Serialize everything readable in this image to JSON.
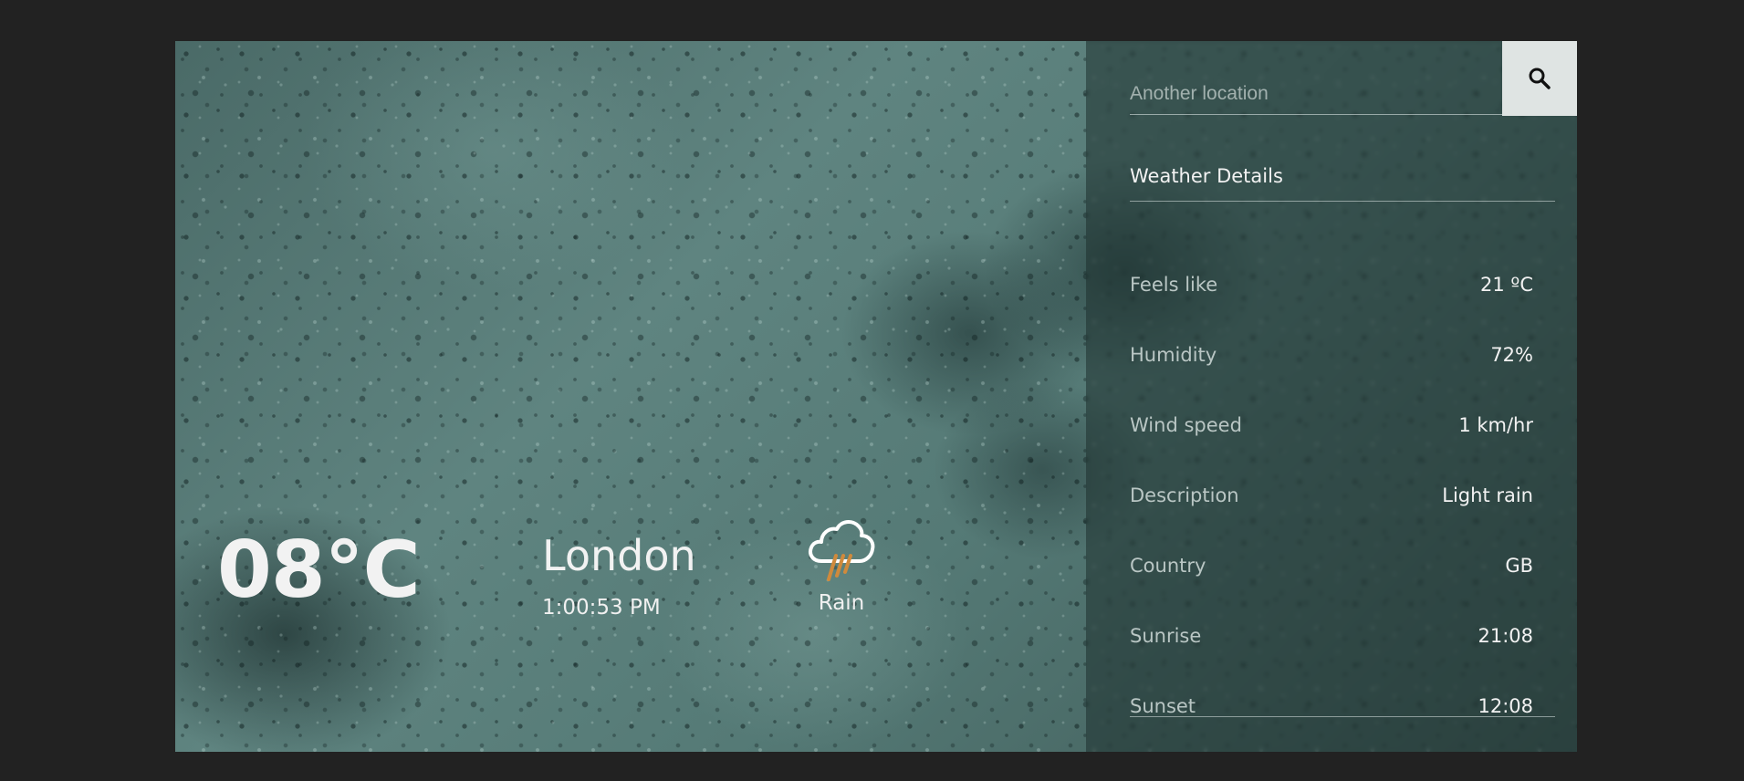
{
  "main": {
    "temperature": "08°C",
    "city": "London",
    "time": "1:00:53 PM",
    "condition": {
      "label": "Rain",
      "icon": "rain-cloud-icon"
    }
  },
  "search": {
    "placeholder": "Another location",
    "value": "",
    "icon": "search-icon"
  },
  "details": {
    "title": "Weather Details",
    "rows": [
      {
        "label": "Feels like",
        "value": "21 ºC"
      },
      {
        "label": "Humidity",
        "value": "72%"
      },
      {
        "label": "Wind speed",
        "value": "1 km/hr"
      },
      {
        "label": "Description",
        "value": "Light rain"
      },
      {
        "label": "Country",
        "value": "GB"
      },
      {
        "label": "Sunrise",
        "value": "21:08"
      },
      {
        "label": "Sunset",
        "value": "12:08"
      }
    ]
  },
  "colors": {
    "page_background": "#222222",
    "rain_stroke": "#d08a3c",
    "search_button": "#dfe4e3"
  }
}
